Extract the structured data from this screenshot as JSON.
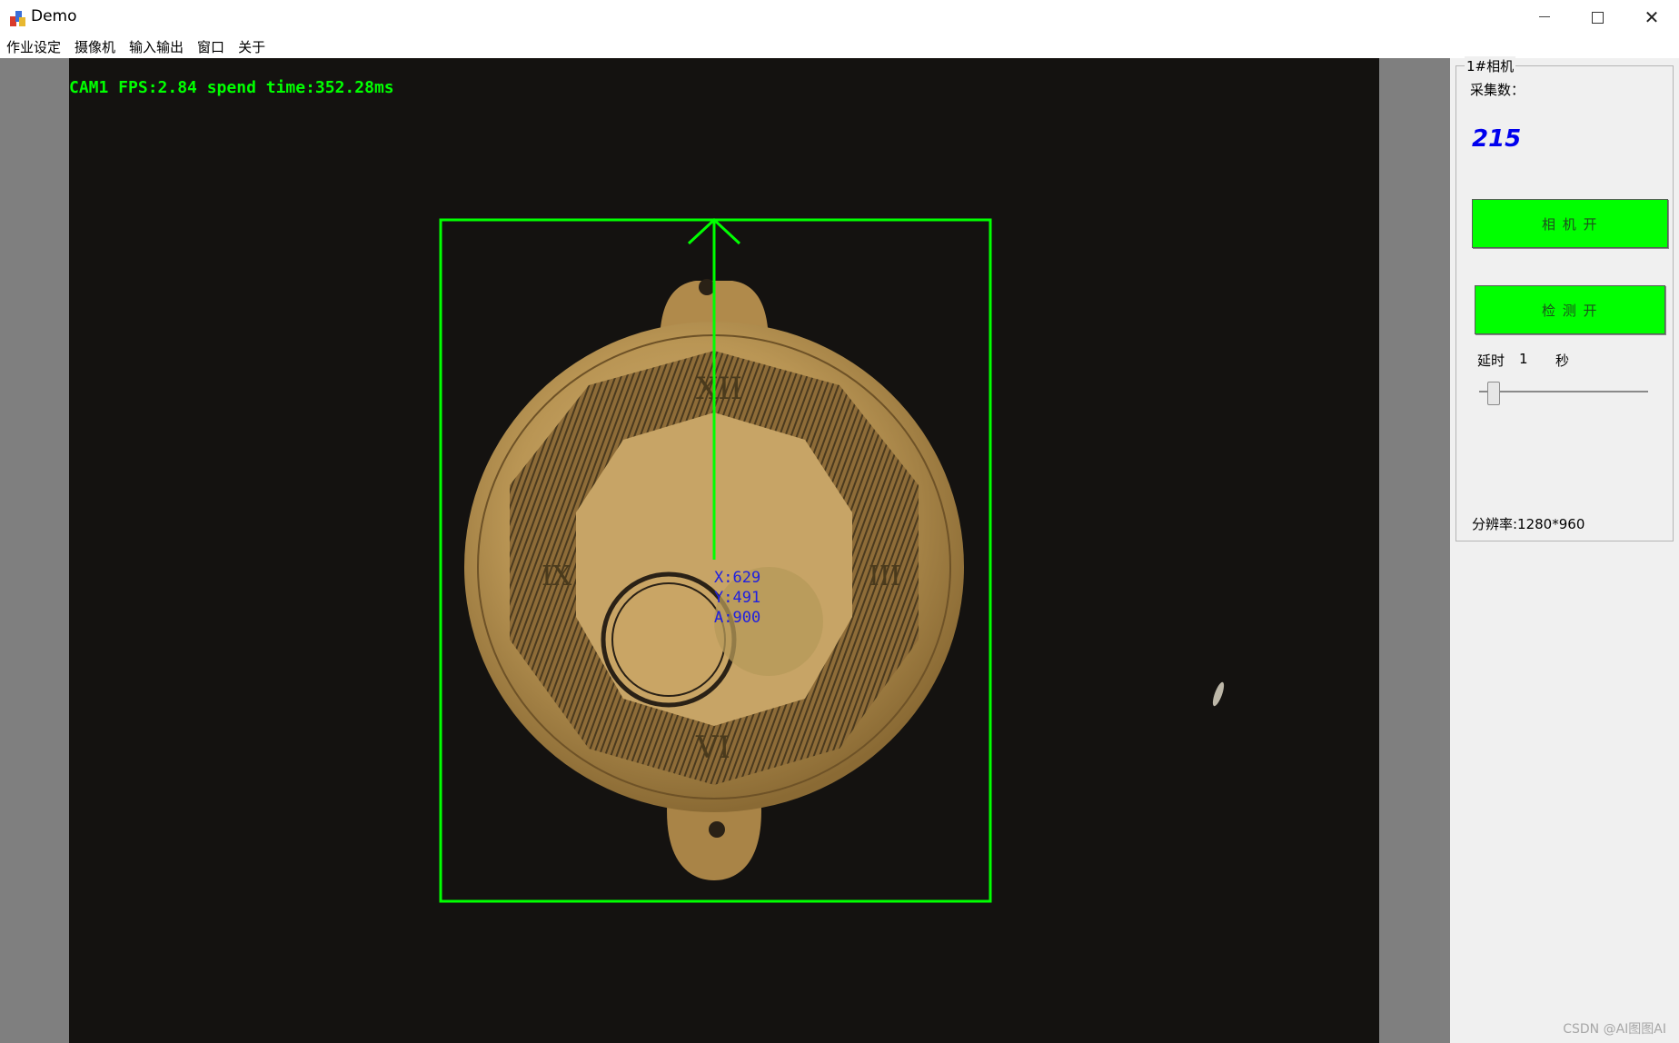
{
  "window": {
    "title": "Demo"
  },
  "menu": [
    {
      "label": "作业设定"
    },
    {
      "label": "摄像机"
    },
    {
      "label": "输入输出"
    },
    {
      "label": "窗口"
    },
    {
      "label": "关于"
    }
  ],
  "camera_view": {
    "overlay": "CAM1  FPS:2.84   spend time:352.28ms",
    "detection": {
      "x": "X:629",
      "y": "Y:491",
      "a": "A:900"
    },
    "colors": {
      "overlay": "#00ff00",
      "coords": "#2020e0"
    }
  },
  "panel": {
    "group_title": "1#相机",
    "capture_label": "采集数：",
    "capture_count": "215",
    "camera_button": "相 机 开",
    "detect_button": "检 测 开",
    "delay_label": "延时",
    "delay_value": "1",
    "delay_unit": "秒",
    "delay_slider_value": 1,
    "resolution": "分辨率:1280*960",
    "accent_color": "#00ff00"
  },
  "watermark": "CSDN @AI图图AI",
  "icons": [
    "app-icon",
    "minimize-icon",
    "maximize-icon",
    "close-icon"
  ]
}
